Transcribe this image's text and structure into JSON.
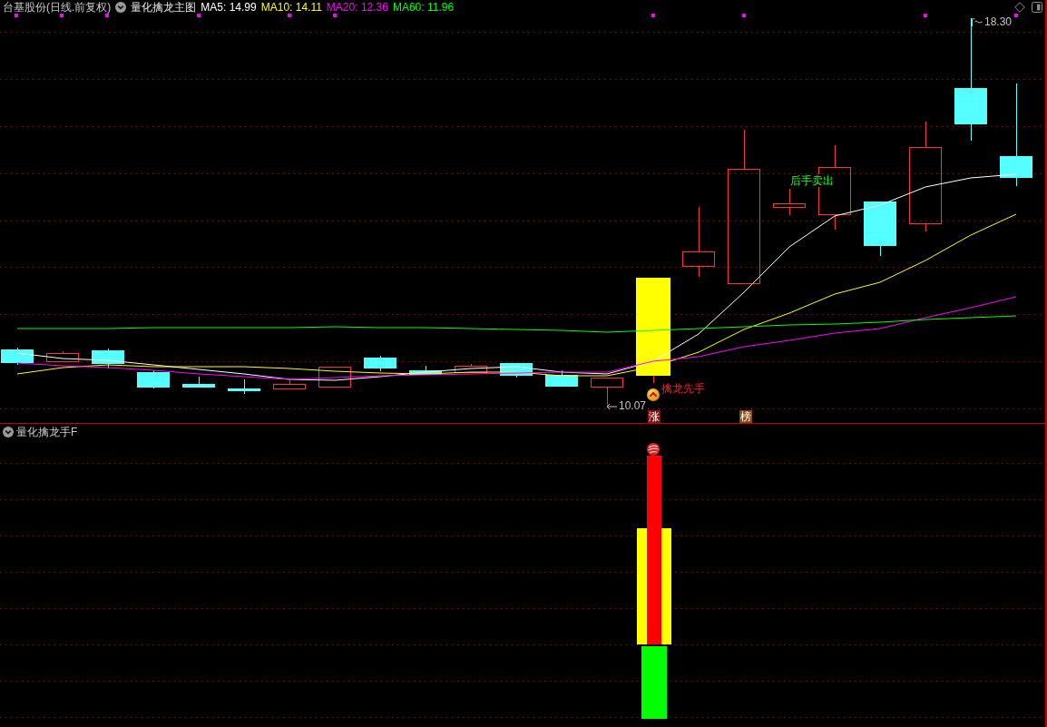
{
  "header": {
    "title": "台基股份(日线.前复权)",
    "indicator": "量化擒龙主图",
    "moving_averages": [
      {
        "label": "MA5: 14.99",
        "color": "#ffffff"
      },
      {
        "label": "MA10: 14.11",
        "color": "#ffff00"
      },
      {
        "label": "MA20: 12.36",
        "color": "#ff00ff"
      },
      {
        "label": "MA60: 11.96",
        "color": "#00ff00"
      }
    ]
  },
  "price_chart": {
    "high_label": "18.30",
    "low_label": "10.07",
    "signals": [
      {
        "kind": "sell",
        "text": "后手卖出"
      },
      {
        "kind": "buy",
        "text": "擒龙先手"
      }
    ],
    "tags": [
      {
        "text": "涨",
        "color": "#8c0e0e"
      },
      {
        "text": "榜",
        "color": "#8a4a0c"
      }
    ]
  },
  "sub_panel": {
    "title": "量化擒龙手F"
  }
}
